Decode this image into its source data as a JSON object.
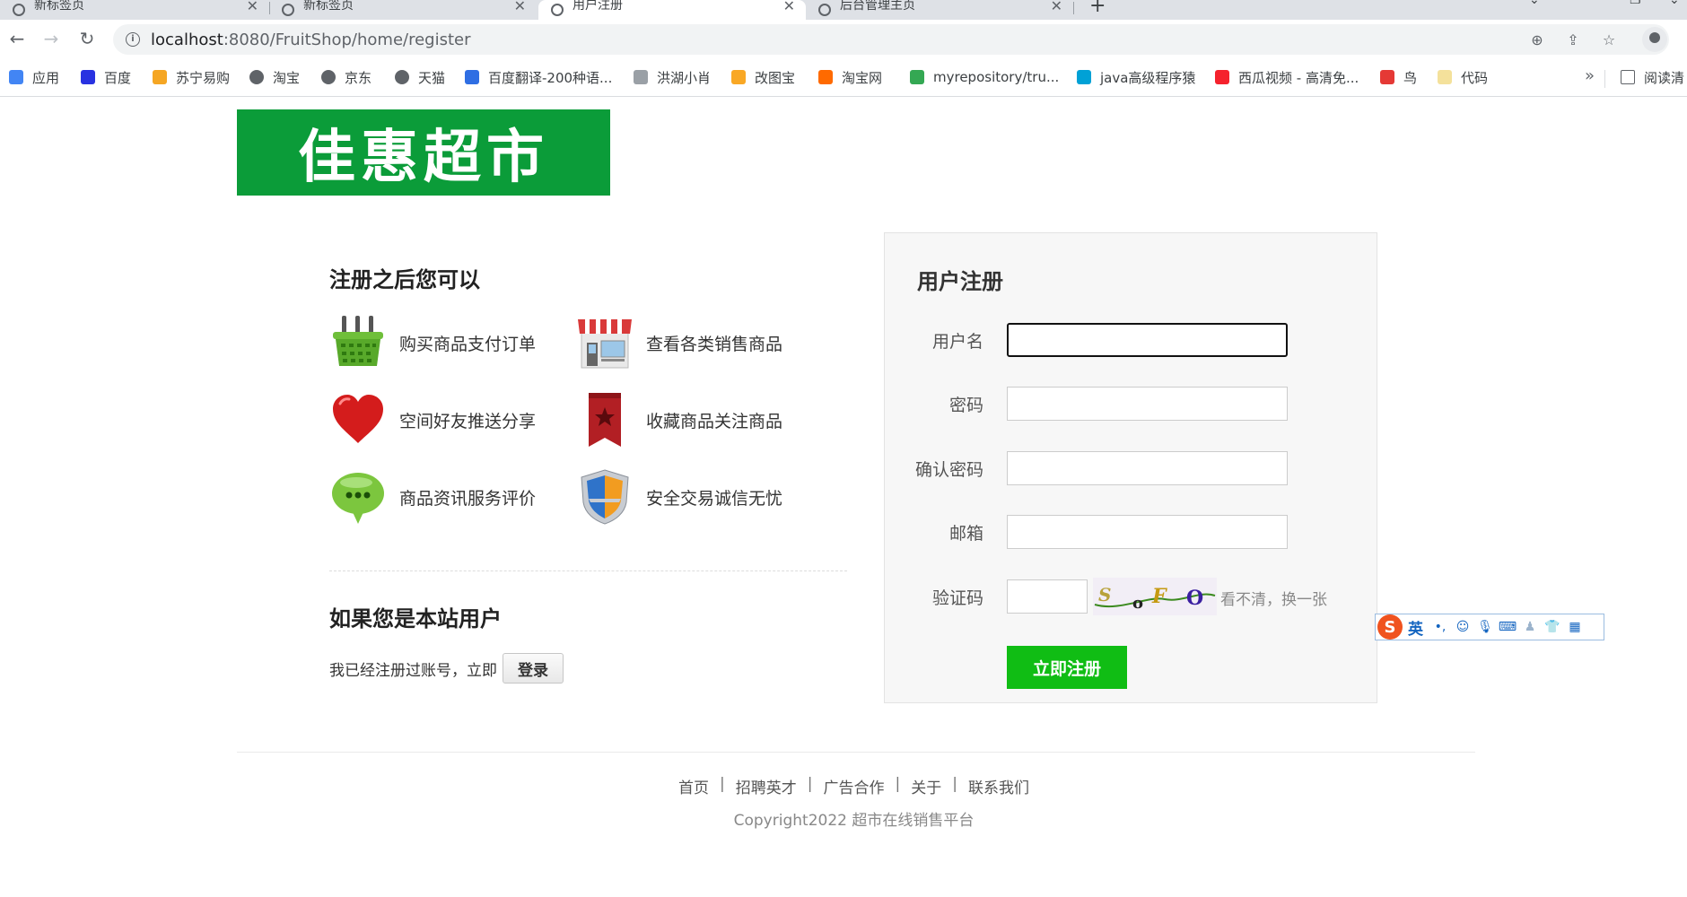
{
  "browser": {
    "tabs": [
      {
        "title": "新标签页",
        "active": false
      },
      {
        "title": "新标签页",
        "active": false
      },
      {
        "title": "用户注册",
        "active": true
      },
      {
        "title": "后台管理主页",
        "active": false
      }
    ],
    "url_host": "localhost",
    "url_rest": ":8080/FruitShop/home/register",
    "bookmarks": [
      {
        "label": "应用",
        "color": "#4285f4"
      },
      {
        "label": "百度",
        "color": "#2932e1"
      },
      {
        "label": "苏宁易购",
        "color": "#f5a623"
      },
      {
        "label": "淘宝",
        "color": "#5f6368"
      },
      {
        "label": "京东",
        "color": "#5f6368"
      },
      {
        "label": "天猫",
        "color": "#5f6368"
      },
      {
        "label": "百度翻译-200种语...",
        "color": "#2f6ee3"
      },
      {
        "label": "洪湖小肖",
        "color": "#9aa0a6"
      },
      {
        "label": "改图宝",
        "color": "#f9a825"
      },
      {
        "label": "淘宝网",
        "color": "#ff6a00"
      },
      {
        "label": "myrepository/tru...",
        "color": "#34a853"
      },
      {
        "label": "java高级程序猿",
        "color": "#00a1d6"
      },
      {
        "label": "西瓜视频 - 高清免...",
        "color": "#f5222d"
      },
      {
        "label": "鸟",
        "color": "#e53935"
      },
      {
        "label": "代码",
        "color": "#f4e19b"
      }
    ],
    "reading_list": "阅读清"
  },
  "logo_text": "佳惠超市",
  "benefits": {
    "title": "注册之后您可以",
    "items": [
      {
        "label": "购买商品支付订单",
        "icon": "basket-icon"
      },
      {
        "label": "查看各类销售商品",
        "icon": "store-icon"
      },
      {
        "label": "空间好友推送分享",
        "icon": "heart-icon"
      },
      {
        "label": "收藏商品关注商品",
        "icon": "bookmark-icon"
      },
      {
        "label": "商品资讯服务评价",
        "icon": "chat-bubble-icon"
      },
      {
        "label": "安全交易诚信无忧",
        "icon": "shield-icon"
      }
    ]
  },
  "member": {
    "title": "如果您是本站用户",
    "text": "我已经注册过账号，立即",
    "login_label": "登录"
  },
  "register": {
    "title": "用户注册",
    "username_label": "用户名",
    "password_label": "密码",
    "confirm_label": "确认密码",
    "email_label": "邮箱",
    "captcha_label": "验证码",
    "captcha_chars": "S o F O",
    "refresh_label": "看不清，换一张",
    "submit_label": "立即注册"
  },
  "footer": {
    "links": [
      "首页",
      "招聘英才",
      "广告合作",
      "关于",
      "联系我们"
    ],
    "copyright": "Copyright2022 超市在线销售平台"
  },
  "ime": {
    "logo": "S",
    "mode": "英"
  }
}
